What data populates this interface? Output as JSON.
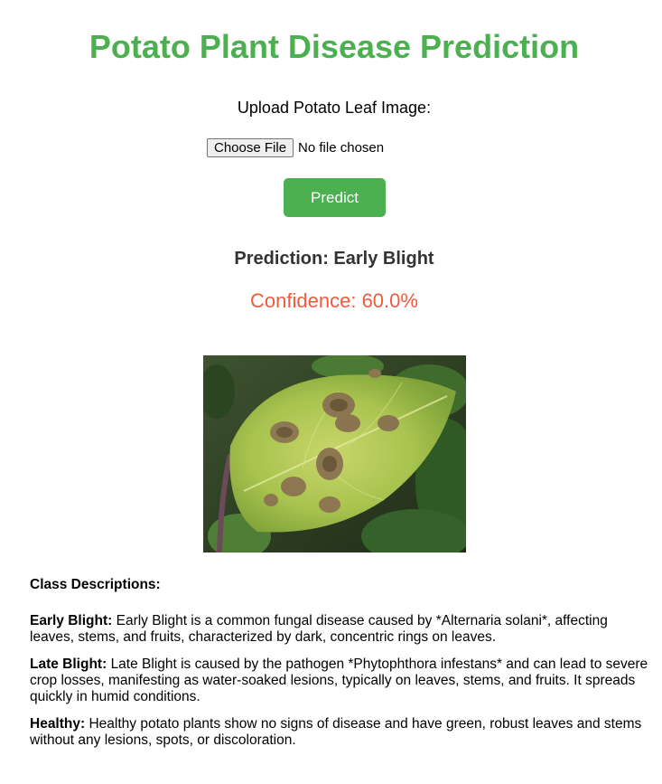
{
  "page": {
    "title": "Potato Plant Disease Prediction"
  },
  "upload": {
    "label": "Upload Potato Leaf Image:",
    "choose_button": "Choose File",
    "file_status": "No file chosen"
  },
  "predict_button": "Predict",
  "result": {
    "prediction": "Prediction: Early Blight",
    "confidence": "Confidence: 60.0%"
  },
  "descriptions": {
    "heading": "Class Descriptions:",
    "items": [
      {
        "name": "Early Blight:",
        "text": "Early Blight is a common fungal disease caused by *Alternaria solani*, affecting leaves, stems, and fruits, characterized by dark, concentric rings on leaves."
      },
      {
        "name": "Late Blight:",
        "text": "Late Blight is caused by the pathogen *Phytophthora infestans* and can lead to severe crop losses, manifesting as water-soaked lesions, typically on leaves, stems, and fruits. It spreads quickly in humid conditions."
      },
      {
        "name": "Healthy:",
        "text": "Healthy potato plants show no signs of disease and have green, robust leaves and stems without any lesions, spots, or discoloration."
      }
    ]
  },
  "colors": {
    "accent": "#4caf50",
    "confidence": "#f05a3c",
    "prediction_text": "#333333"
  },
  "icons": {
    "leaf_image": "potato-leaf-photo"
  }
}
